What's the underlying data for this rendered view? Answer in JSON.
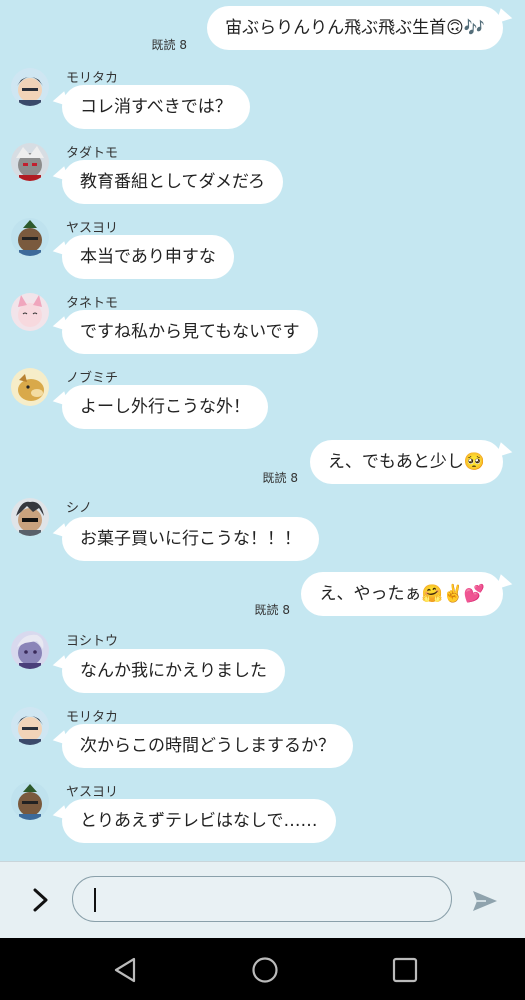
{
  "chat": {
    "messages": [
      {
        "direction": "out",
        "text": "宙ぶらりんりん飛ぶ飛ぶ生首🙃🎶",
        "read": "既読 8"
      },
      {
        "direction": "in",
        "sender": "モリタカ",
        "text": "コレ消すべきでは？"
      },
      {
        "direction": "in",
        "sender": "タダトモ",
        "text": "教育番組としてダメだろ"
      },
      {
        "direction": "in",
        "sender": "ヤスヨリ",
        "text": "本当であり申すな"
      },
      {
        "direction": "in",
        "sender": "タネトモ",
        "text": "ですね私から見てもないです"
      },
      {
        "direction": "in",
        "sender": "ノブミチ",
        "text": "よーし外行こうな外！"
      },
      {
        "direction": "out",
        "text": "え、でもあと少し🥺",
        "read": "既読 8"
      },
      {
        "direction": "in",
        "sender": "シノ",
        "text": "お菓子買いに行こうな！！！"
      },
      {
        "direction": "out",
        "text": "え、やったぁ🤗✌️💕",
        "read": "既読 8"
      },
      {
        "direction": "in",
        "sender": "ヨシトウ",
        "text": "なんか我にかえりました"
      },
      {
        "direction": "in",
        "sender": "モリタカ",
        "text": "次からこの時間どうしまするか？"
      },
      {
        "direction": "in",
        "sender": "ヤスヨリ",
        "text": "とりあえずテレビはなしで……"
      }
    ]
  },
  "composer": {
    "input_value": "",
    "expand_icon": "chevron-right-icon",
    "send_icon": "send-icon"
  },
  "navbar": {
    "icons": [
      "back-triangle-icon",
      "home-circle-icon",
      "recents-square-icon"
    ]
  },
  "colors": {
    "background": "#c5e7f1",
    "bubble": "#ffffff",
    "composer": "#e7f0f3",
    "navbar": "#000000"
  }
}
